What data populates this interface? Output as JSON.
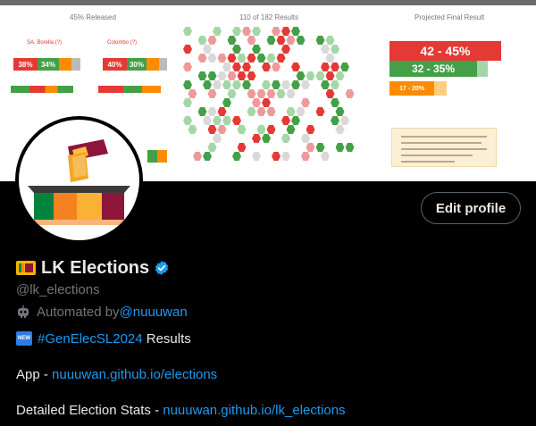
{
  "banner": {
    "panel_left_title": "45% Released",
    "panel_mid_title": "110 of 182 Results",
    "panel_right_title": "Projected Final Result",
    "district_1": "SA. Borella (?)",
    "district_2": "Colombo (?)",
    "pct_left_1": "38%",
    "pct_left_2": "34%",
    "pct_mid_1": "40%",
    "pct_mid_2": "30%",
    "proj_1": "42 - 45%",
    "proj_2": "32 - 35%",
    "proj_3": "17 - 20%",
    "colors": {
      "red": "#e53935",
      "green": "#43a047",
      "orange": "#fb8c00"
    }
  },
  "profile": {
    "display_name": "LK Elections",
    "handle": "@lk_elections",
    "automated_prefix": "Automated by ",
    "automated_link": "@nuuuwan",
    "edit_button": "Edit profile",
    "verified_color": "#1d9bf0",
    "bio": {
      "badge_icon": "NEW",
      "hashtag": "#GenElecSL2024",
      "hashtag_suffix": " Results",
      "app_prefix": "App - ",
      "app_link": "nuuuwan.github.io/elections",
      "stats_prefix": "Detailed Election Stats - ",
      "stats_link": "nuuuwan.github.io/lk_elections"
    }
  }
}
